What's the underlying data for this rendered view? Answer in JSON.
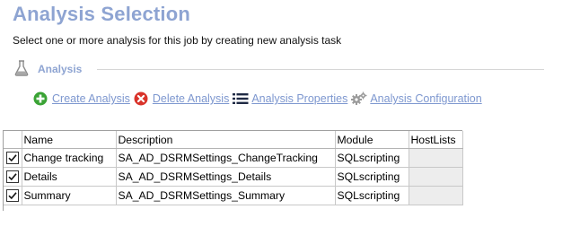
{
  "page": {
    "title": "Analysis Selection",
    "subtitle": "Select one or more analysis for this job by creating new analysis task"
  },
  "section": {
    "label": "Analysis",
    "icon": "flask-icon"
  },
  "toolbar": {
    "create_label": "Create Analysis",
    "delete_label": "Delete Analysis",
    "properties_label": "Analysis Properties",
    "configuration_label": "Analysis Configuration"
  },
  "table": {
    "columns": [
      "",
      "Name",
      "Description",
      "Module",
      "HostLists"
    ],
    "rows": [
      {
        "checked": true,
        "name": "Change tracking",
        "description": "SA_AD_DSRMSettings_ChangeTracking",
        "module": "SQLscripting",
        "hostlists": ""
      },
      {
        "checked": true,
        "name": "Details",
        "description": "SA_AD_DSRMSettings_Details",
        "module": "SQLscripting",
        "hostlists": ""
      },
      {
        "checked": true,
        "name": "Summary",
        "description": "SA_AD_DSRMSettings_Summary",
        "module": "SQLscripting",
        "hostlists": ""
      }
    ]
  },
  "colors": {
    "title": "#8ea4d2",
    "link": "#7d97cf",
    "create_icon": "#3aa335",
    "delete_icon": "#d9342b"
  }
}
